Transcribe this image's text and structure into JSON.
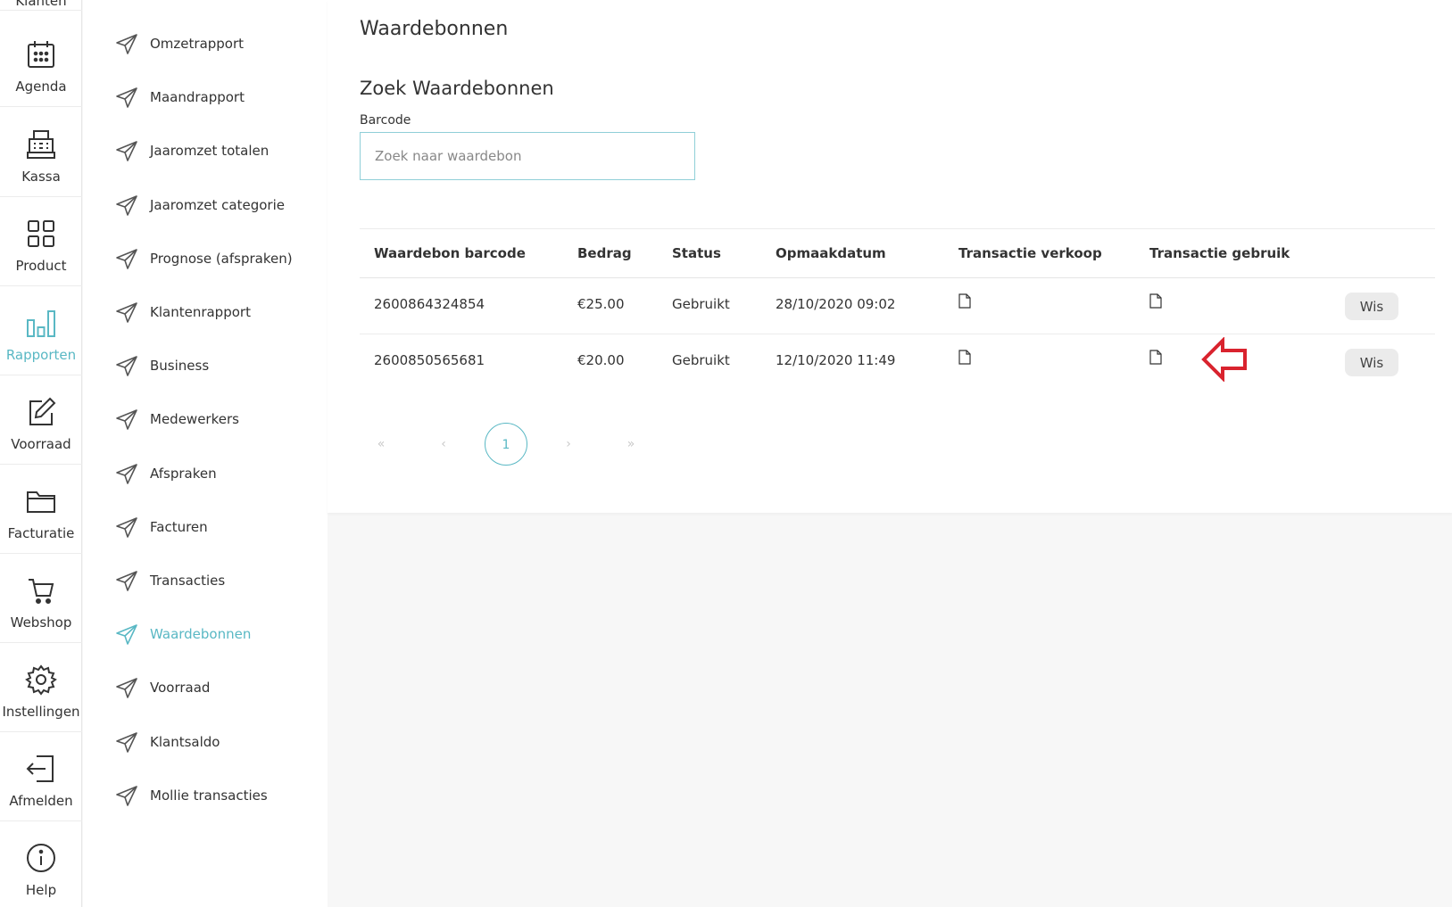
{
  "rail": {
    "top_label": "Klanten",
    "items": [
      {
        "label": "Agenda",
        "icon": "calendar-icon"
      },
      {
        "label": "Kassa",
        "icon": "cash-register-icon"
      },
      {
        "label": "Product",
        "icon": "grid-icon"
      },
      {
        "label": "Rapporten",
        "icon": "bar-chart-icon",
        "active": true
      },
      {
        "label": "Voorraad",
        "icon": "edit-icon"
      },
      {
        "label": "Facturatie",
        "icon": "folder-icon"
      },
      {
        "label": "Webshop",
        "icon": "cart-icon"
      },
      {
        "label": "Instellingen",
        "icon": "gear-icon"
      },
      {
        "label": "Afmelden",
        "icon": "logout-icon"
      },
      {
        "label": "Help",
        "icon": "info-icon"
      }
    ]
  },
  "submenu": {
    "items": [
      {
        "label": "Omzetrapport"
      },
      {
        "label": "Maandrapport"
      },
      {
        "label": "Jaaromzet totalen"
      },
      {
        "label": "Jaaromzet categorie"
      },
      {
        "label": "Prognose (afspraken)"
      },
      {
        "label": "Klantenrapport"
      },
      {
        "label": "Business"
      },
      {
        "label": "Medewerkers"
      },
      {
        "label": "Afspraken"
      },
      {
        "label": "Facturen"
      },
      {
        "label": "Transacties"
      },
      {
        "label": "Waardebonnen",
        "active": true
      },
      {
        "label": "Voorraad"
      },
      {
        "label": "Klantsaldo"
      },
      {
        "label": "Mollie transacties"
      }
    ]
  },
  "main": {
    "title": "Waardebonnen",
    "section_title": "Zoek Waardebonnen",
    "search": {
      "label": "Barcode",
      "placeholder": "Zoek naar waardebon",
      "value": ""
    },
    "table": {
      "columns": [
        "Waardebon barcode",
        "Bedrag",
        "Status",
        "Opmaakdatum",
        "Transactie verkoop",
        "Transactie gebruik"
      ],
      "rows": [
        {
          "barcode": "2600864324854",
          "bedrag": "€25.00",
          "status": "Gebruikt",
          "datum": "28/10/2020 09:02",
          "action": "Wis"
        },
        {
          "barcode": "2600850565681",
          "bedrag": "€20.00",
          "status": "Gebruikt",
          "datum": "12/10/2020 11:49",
          "action": "Wis"
        }
      ]
    },
    "pagination": {
      "first": "«",
      "prev": "‹",
      "current": "1",
      "next": "›",
      "last": "»"
    }
  },
  "colors": {
    "accent": "#59b8c4",
    "annotation": "#d9232e"
  }
}
